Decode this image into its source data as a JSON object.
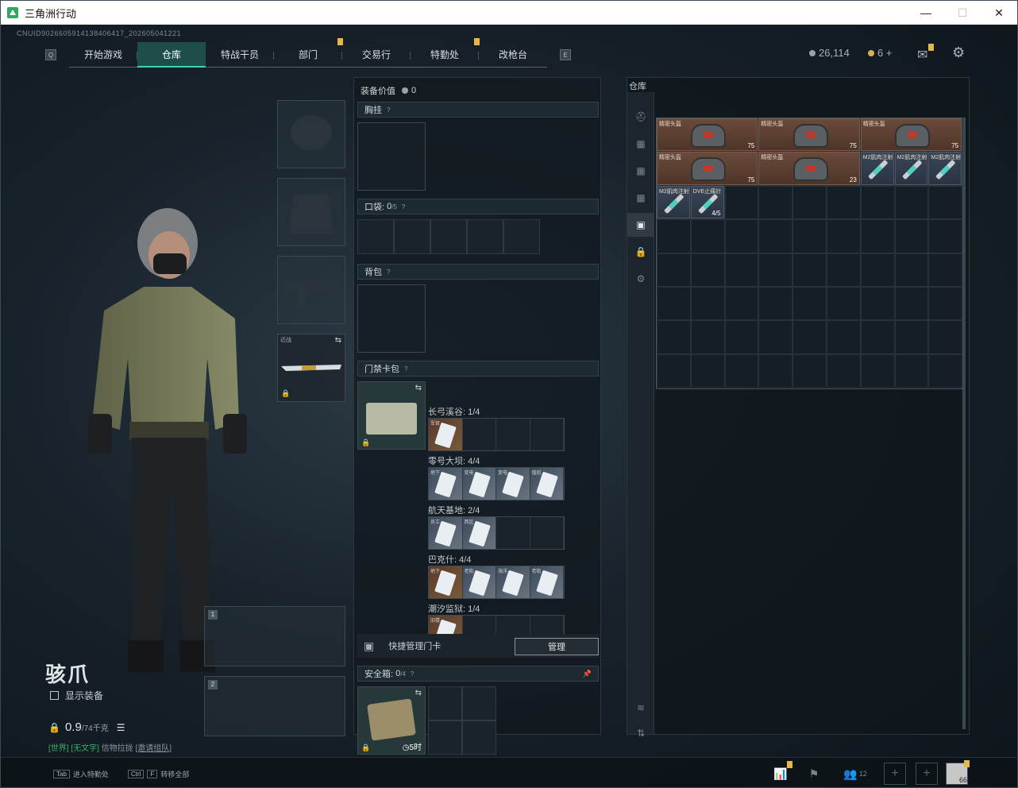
{
  "window": {
    "title": "三角洲行动",
    "min": "—",
    "max": "☐",
    "close": "✕"
  },
  "uid": "CNUID9026605914138406417_202605041221",
  "nav": {
    "left_key": "Q",
    "right_key": "E",
    "tabs": [
      {
        "label": "开始游戏"
      },
      {
        "label": "仓库"
      },
      {
        "label": "特战干员"
      },
      {
        "label": "部门"
      },
      {
        "label": "交易行"
      },
      {
        "label": "特勤处"
      },
      {
        "label": "改枪台"
      }
    ],
    "active": "仓库"
  },
  "currency": {
    "silver": "26,114",
    "gold": "6",
    "plus": "+"
  },
  "operator": {
    "name": "骇爪",
    "show_equip": "显示装备",
    "weight": "0.9",
    "weight_max": "/74千克",
    "status_a": "[世界]",
    "status_b": "[无文字]",
    "status_c": "信物拉拢",
    "status_d": "[邀请组队]"
  },
  "weapons": {
    "melee_label": "近战",
    "slot1": "1",
    "slot2": "2"
  },
  "equip": {
    "value_label": "装备价值",
    "value": "0",
    "chest_label": "胸挂",
    "pockets_label": "口袋:",
    "pockets_val": "0",
    "pockets_max": "/5",
    "backpack_label": "背包",
    "keycard_label": "门禁卡包",
    "maps": [
      {
        "label": "长弓溪谷: 1/4",
        "cells": [
          {
            "t": "o",
            "n": "军官"
          },
          {
            "t": "e"
          },
          {
            "t": "e"
          },
          {
            "t": "e"
          }
        ]
      },
      {
        "label": "零号大坝: 4/4",
        "cells": [
          {
            "t": "f",
            "n": "地下"
          },
          {
            "t": "f",
            "n": "变电"
          },
          {
            "t": "f",
            "n": "变电"
          },
          {
            "t": "f",
            "n": "值班"
          }
        ]
      },
      {
        "label": "航天基地: 2/4",
        "cells": [
          {
            "t": "f",
            "n": "员工"
          },
          {
            "t": "f",
            "n": "西区"
          },
          {
            "t": "e"
          },
          {
            "t": "e"
          }
        ]
      },
      {
        "label": "巴克什: 4/4",
        "cells": [
          {
            "t": "o",
            "n": "地下"
          },
          {
            "t": "f",
            "n": "老街"
          },
          {
            "t": "f",
            "n": "海洋"
          },
          {
            "t": "f",
            "n": "老街"
          }
        ]
      },
      {
        "label": "潮汐监狱: 1/4",
        "cells": [
          {
            "t": "o",
            "n": "旧楼"
          },
          {
            "t": "e"
          },
          {
            "t": "e"
          },
          {
            "t": "e"
          }
        ]
      }
    ],
    "quick_manage": "快捷管理门卡",
    "manage_btn": "管理",
    "safebox_label": "安全箱:",
    "safebox_val": "0",
    "safebox_max": "/4",
    "safebox_time": "5时"
  },
  "stash": {
    "title": "仓库",
    "items": [
      {
        "type": "helmet",
        "name": "精密头盔",
        "dur": "75"
      },
      {
        "type": "helmet",
        "name": "精密头盔",
        "dur": "75"
      },
      {
        "type": "helmet",
        "name": "精密头盔",
        "dur": "75"
      },
      {
        "type": "helmet",
        "name": "精密头盔",
        "dur": "75"
      },
      {
        "type": "helmet",
        "name": "精密头盔",
        "dur": "23"
      },
      {
        "type": "syr",
        "name": "M2肌肉注射"
      },
      {
        "type": "syr",
        "name": "M2肌肉注射"
      },
      {
        "type": "syr",
        "name": "M2肌肉注射"
      },
      {
        "type": "syr",
        "name": "M2肌肉注射"
      },
      {
        "type": "syr",
        "name": "DVE止痛针",
        "dur": "4/5"
      }
    ]
  },
  "bottom": {
    "tab_key": "Tab",
    "tab_hint": "进入特勤处",
    "ctrl_key": "Ctrl",
    "f_key": "F",
    "ctrl_hint": "转移全部",
    "friends": "12",
    "lvl": "66"
  }
}
